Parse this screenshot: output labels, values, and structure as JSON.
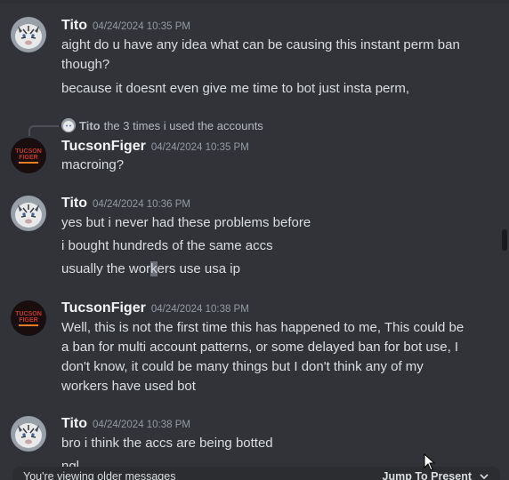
{
  "messages": [
    {
      "author": "Tito",
      "timestamp": "04/24/2024 10:35 PM",
      "lines": [
        "aight do u have any idea what can be causing this instant perm ban though?",
        "because it doesnt even give me time to bot just insta perm,"
      ]
    },
    {
      "author": "TucsonFiger",
      "timestamp": "04/24/2024 10:35 PM",
      "reply": {
        "author": "Tito",
        "text": "the 3 times i used the accounts"
      },
      "lines": [
        "macroing?"
      ]
    },
    {
      "author": "Tito",
      "timestamp": "04/24/2024 10:36 PM",
      "lines": [
        "yes but i never had these problems before",
        "i bought hundreds of the same accs",
        "usually the workers use usa ip"
      ],
      "line3_parts": [
        "usually the wor",
        "k",
        "ers use usa ip"
      ]
    },
    {
      "author": "TucsonFiger",
      "timestamp": "04/24/2024 10:38 PM",
      "lines": [
        "Well, this is not the first time this has happened to me, This could be a ban for multi account patterns, or some delayed ban for bot use, I don't know, it could be many things but I don't think any of my workers have used bot"
      ]
    },
    {
      "author": "Tito",
      "timestamp": "04/24/2024 10:38 PM",
      "lines": [
        "bro i think the accs are being botted",
        "ngl"
      ]
    }
  ],
  "older_bar": {
    "notice": "You're viewing older messages",
    "jump_label": "Jump To Present"
  },
  "avatars": {
    "tito": "white-tiger-avatar",
    "tucson": "tucson-figer-logo-avatar",
    "tucson_logo_text": [
      "TUCSON",
      "FIGER"
    ]
  },
  "colors": {
    "background": "#313338",
    "username": "#f2f3f5",
    "timestamp": "#949ba4",
    "tucson_logo": "#c0392b"
  }
}
